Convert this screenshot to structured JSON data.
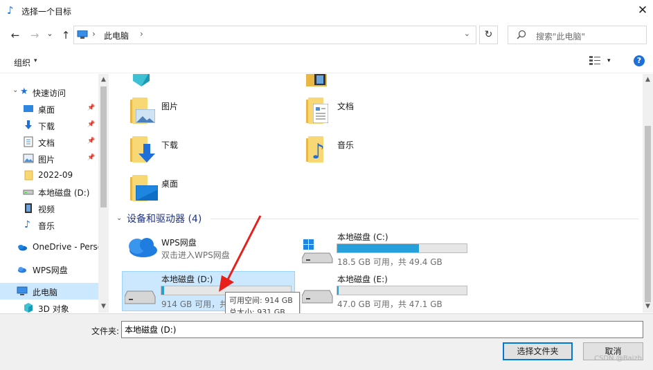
{
  "window": {
    "title": "选择一个目标",
    "close": "✕"
  },
  "nav": {
    "back": "←",
    "forward": "→",
    "recent": "⌄",
    "up": "↑",
    "refresh": "↻"
  },
  "address": {
    "sep": "›",
    "current": "此电脑",
    "dropdown": "⌄"
  },
  "search": {
    "placeholder": "搜索\"此电脑\""
  },
  "toolbar": {
    "organize": "组织",
    "caret": "▾",
    "help": "?"
  },
  "sidebar": {
    "items": [
      {
        "label": "快速访问",
        "icon": "star-icon"
      },
      {
        "label": "桌面",
        "icon": "desktop-icon",
        "pinned": true
      },
      {
        "label": "下载",
        "icon": "download-icon",
        "pinned": true
      },
      {
        "label": "文档",
        "icon": "document-icon",
        "pinned": true
      },
      {
        "label": "图片",
        "icon": "picture-icon",
        "pinned": true
      },
      {
        "label": "2022-09",
        "icon": "folder-icon"
      },
      {
        "label": "本地磁盘 (D:)",
        "icon": "drive-icon"
      },
      {
        "label": "视频",
        "icon": "video-icon"
      },
      {
        "label": "音乐",
        "icon": "music-icon"
      },
      {
        "label": "OneDrive - Perso",
        "icon": "onedrive-icon"
      },
      {
        "label": "WPS网盘",
        "icon": "wps-cloud-icon"
      },
      {
        "label": "此电脑",
        "icon": "pc-icon",
        "selected": true
      },
      {
        "label": "3D 对象",
        "icon": "3d-objects-icon"
      }
    ],
    "pin_glyph": "📌"
  },
  "folders": [
    {
      "label": "图片",
      "icon": "picture-icon"
    },
    {
      "label": "文档",
      "icon": "document-icon"
    },
    {
      "label": "下载",
      "icon": "download-icon"
    },
    {
      "label": "音乐",
      "icon": "music-icon"
    },
    {
      "label": "桌面",
      "icon": "desktop-icon"
    }
  ],
  "section": {
    "title": "设备和驱动器 (4)",
    "caret": "⌄"
  },
  "drives": [
    {
      "name": "WPS网盘",
      "info": "双击进入WPS网盘",
      "icon": "wps-cloud-icon"
    },
    {
      "name": "本地磁盘 (C:)",
      "info": "18.5 GB 可用，共 49.4 GB",
      "used_fraction": 0.63,
      "icon": "windows-drive-icon"
    },
    {
      "name": "本地磁盘 (D:)",
      "info": "914 GB 可用，共 931 GB",
      "used_fraction": 0.02,
      "icon": "drive-icon",
      "selected": true
    },
    {
      "name": "本地磁盘 (E:)",
      "info": "47.0 GB 可用，共 47.1 GB",
      "used_fraction": 0.01,
      "icon": "drive-icon"
    }
  ],
  "tooltip": {
    "line1": "可用空间: 914 GB",
    "line2": "总大小: 931 GB"
  },
  "bottom": {
    "folder_label": "文件夹:",
    "folder_value": "本地磁盘 (D:)",
    "select_button": "选择文件夹",
    "cancel_button": "取消"
  },
  "watermark": "CSDN @Baizh",
  "colors": {
    "accent": "#0078d7",
    "selection": "#cce8ff",
    "bar_fill": "#26a0da",
    "annotation_arrow": "#e8201c"
  }
}
